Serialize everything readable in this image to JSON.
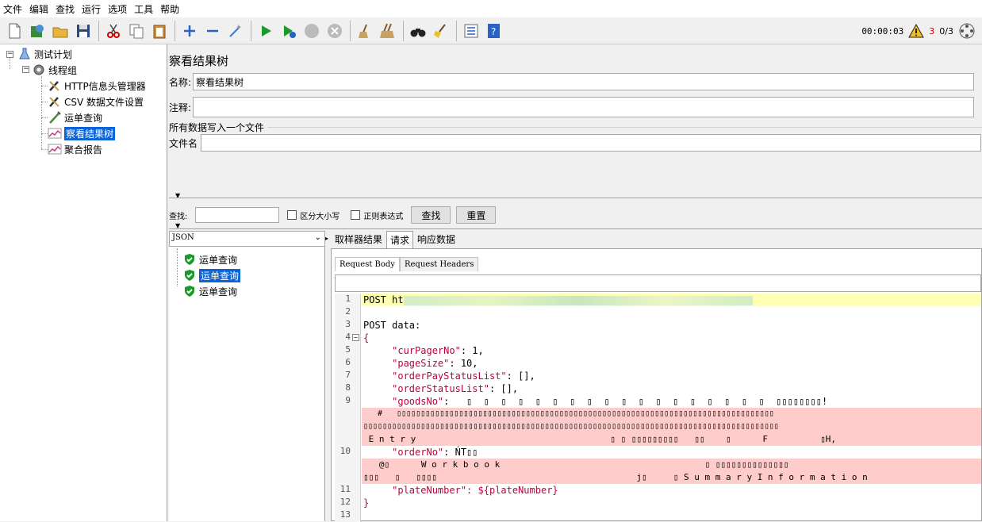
{
  "menu": [
    "文件",
    "编辑",
    "查找",
    "运行",
    "选项",
    "工具",
    "帮助"
  ],
  "toolbar": {
    "timer": "00:00:03",
    "warn_count": "3",
    "threads": "0/3"
  },
  "tree": {
    "root": "测试计划",
    "group": "线程组",
    "items": [
      "HTTP信息头管理器",
      "CSV 数据文件设置",
      "运单查询",
      "察看结果树",
      "聚合报告"
    ]
  },
  "panel": {
    "title": "察看结果树",
    "name_label": "名称:",
    "name_value": "察看结果树",
    "comment_label": "注释:",
    "write_all_label": "所有数据写入一个文件",
    "filename_label": "文件名"
  },
  "search": {
    "label": "查找:",
    "case_label": "区分大小写",
    "regex_label": "正则表达式",
    "find_btn": "查找",
    "reset_btn": "重置"
  },
  "renderer": "JSON",
  "results": [
    "运单查询",
    "运单查询",
    "运单查询"
  ],
  "tabs": [
    "取样器结果",
    "请求",
    "响应数据"
  ],
  "subtabs": [
    "Request Body",
    "Request Headers"
  ],
  "code": {
    "l1_prefix": "POST ht",
    "l3": "POST data:",
    "l4": "{",
    "l5_key": "\"curPagerNo\"",
    "l5_val": ": 1,",
    "l6_key": "\"pageSize\"",
    "l6_val": ": 10,",
    "l7_key": "\"orderPayStatusList\"",
    "l7_val": ": [],",
    "l8_key": "\"orderStatusList\"",
    "l8_val": ": [],",
    "l9_key": "\"goodsNo\"",
    "l9_val": ":   ▯  ▯  ▯  ▯  ▯  ▯  ▯  ▯  ▯  ▯  ▯  ▯  ▯  ▯  ▯  ▯  ▯  ▯  ▯▯▯▯▯▯▯▯!",
    "l9_b": "   #   ▯▯▯▯▯▯▯▯▯▯▯▯▯▯▯▯▯▯▯▯▯▯▯▯▯▯▯▯▯▯▯▯▯▯▯▯▯▯▯▯▯▯▯▯▯▯▯▯▯▯▯▯▯▯▯▯▯▯▯▯▯▯▯▯▯▯▯▯▯▯▯▯▯▯▯▯▯▯▯",
    "l9_c": "▯▯▯▯▯▯▯▯▯▯▯▯▯▯▯▯▯▯▯▯▯▯▯▯▯▯▯▯▯▯▯▯▯▯▯▯▯▯▯▯▯▯▯▯▯▯▯▯▯▯▯▯▯▯▯▯▯▯▯▯▯▯▯▯▯▯▯▯▯▯▯▯▯▯▯▯▯▯▯▯▯▯▯▯▯▯▯",
    "l9_d": " E n t r y                                     ▯ ▯ ▯▯▯▯▯▯▯▯▯   ▯▯    ▯      F          ▯H,",
    "l10_key": "\"orderNo\"",
    "l10_val": ": ŃT▯▯",
    "l10_b": "   @▯      W o r k b o o k                                       ▯ ▯▯▯▯▯▯▯▯▯▯▯▯▯▯",
    "l10_c": "▯▯▯   ▯   ▯▯▯▯                                      j▯     ▯ S u m m a r y I n f o r m a t i o n",
    "l11_key": "\"plateNumber\"",
    "l11_val": ": ${plateNumber}",
    "l12": "}"
  },
  "line_numbers": [
    "1",
    "2",
    "3",
    "4",
    "5",
    "6",
    "7",
    "8",
    "9",
    "10",
    "11",
    "12",
    "13"
  ]
}
